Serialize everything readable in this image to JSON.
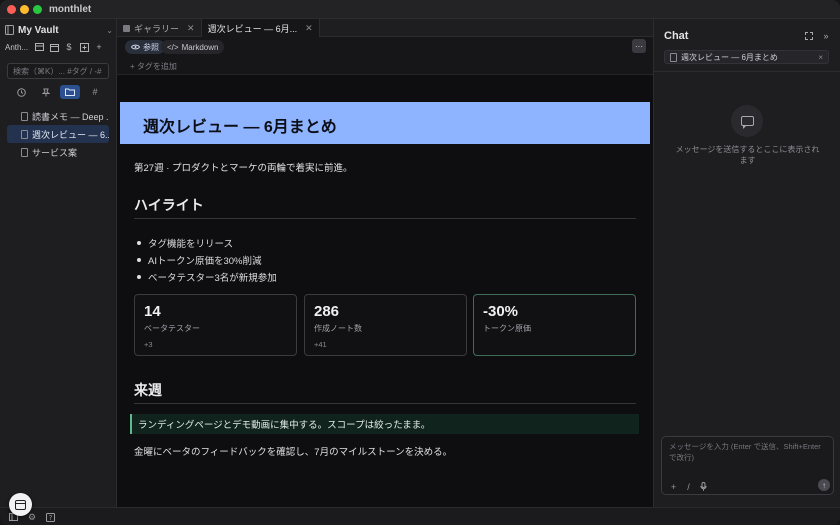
{
  "window": {
    "app_title": "monthlet"
  },
  "sidebar": {
    "vault_name": "My Vault",
    "model_label": "Anth...",
    "search_placeholder": "検索（⌘K）... #タグ / -#",
    "tabs": [
      "recent",
      "pinned",
      "folders",
      "tags"
    ],
    "files": [
      {
        "label": "読書メモ — Deep ...",
        "active": false
      },
      {
        "label": "週次レビュー — 6...",
        "active": true
      },
      {
        "label": "サービス案",
        "active": false
      }
    ]
  },
  "editor": {
    "tabs": [
      {
        "label": "ギャラリー",
        "active": false
      },
      {
        "label": "週次レビュー — 6月...",
        "active": true
      }
    ],
    "view_label": "参照",
    "markdown_label": "Markdown",
    "more_label": "···",
    "add_tag_label": "+ タグを追加"
  },
  "document": {
    "title": "週次レビュー — 6月まとめ",
    "lead": "第27週 · プロダクトとマーケの両輪で着実に前進。",
    "highlights_heading": "ハイライト",
    "bullets": [
      "タグ機能をリリース",
      "AIトークン原価を30%削減",
      "ベータテスター3名が新規参加"
    ],
    "stats": [
      {
        "value": "14",
        "label": "ベータテスター",
        "delta": "+3"
      },
      {
        "value": "286",
        "label": "作成ノート数",
        "delta": "+41"
      },
      {
        "value": "-30%",
        "label": "トークン原価",
        "delta": ""
      }
    ],
    "next_heading": "来週",
    "callout": "ランディングページとデモ動画に集中する。スコープは絞ったまま。",
    "paragraph": "金曜にベータのフィードバックを確認し、7月のマイルストーンを決める。",
    "title_band_color": "#8eb3ff",
    "callout_color": "#5fb98e"
  },
  "chat": {
    "title": "Chat",
    "context_chip": "週次レビュー — 6月まとめ",
    "empty_message": "メッセージを送信するとここに表示されます",
    "input_placeholder": "メッセージを入力 (Enter で送信、Shift+Enter で改行)"
  }
}
